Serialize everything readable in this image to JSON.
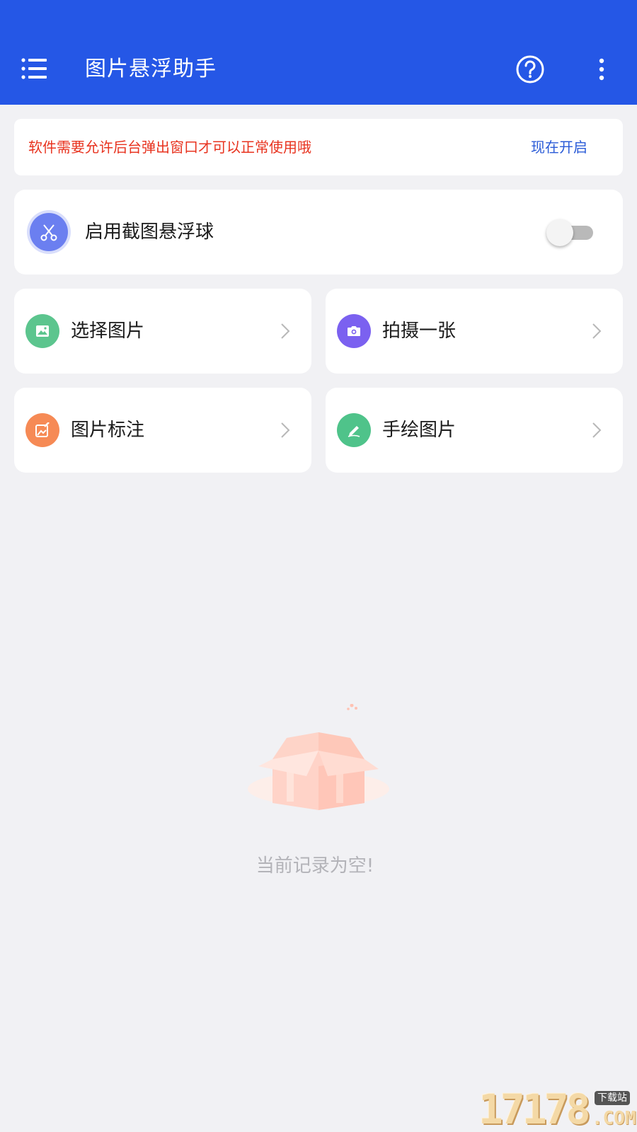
{
  "app_bar": {
    "title": "图片悬浮助手",
    "menu_icon": "menu-icon",
    "help_icon": "help-circle-icon",
    "more_icon": "more-vertical-icon",
    "color": "#2557e6"
  },
  "notice": {
    "message": "软件需要允许后台弹出窗口才可以正常使用哦",
    "action": "现在开启",
    "message_color": "#e8331f",
    "action_color": "#2a5bd7"
  },
  "float_toggle": {
    "label": "启用截图悬浮球",
    "icon": "scissors-icon",
    "enabled": false
  },
  "actions": [
    {
      "label": "选择图片",
      "icon": "image-icon",
      "color": "#5cc58e"
    },
    {
      "label": "拍摄一张",
      "icon": "camera-icon",
      "color": "#7b61f0"
    },
    {
      "label": "图片标注",
      "icon": "edit-image-icon",
      "color": "#f68a55"
    },
    {
      "label": "手绘图片",
      "icon": "pen-icon",
      "color": "#4fc38a"
    }
  ],
  "empty_state": {
    "text": "当前记录为空!",
    "icon": "empty-box-icon"
  },
  "watermark": {
    "digits": "17178",
    "tag": "下载站",
    "domain": ".COM"
  }
}
